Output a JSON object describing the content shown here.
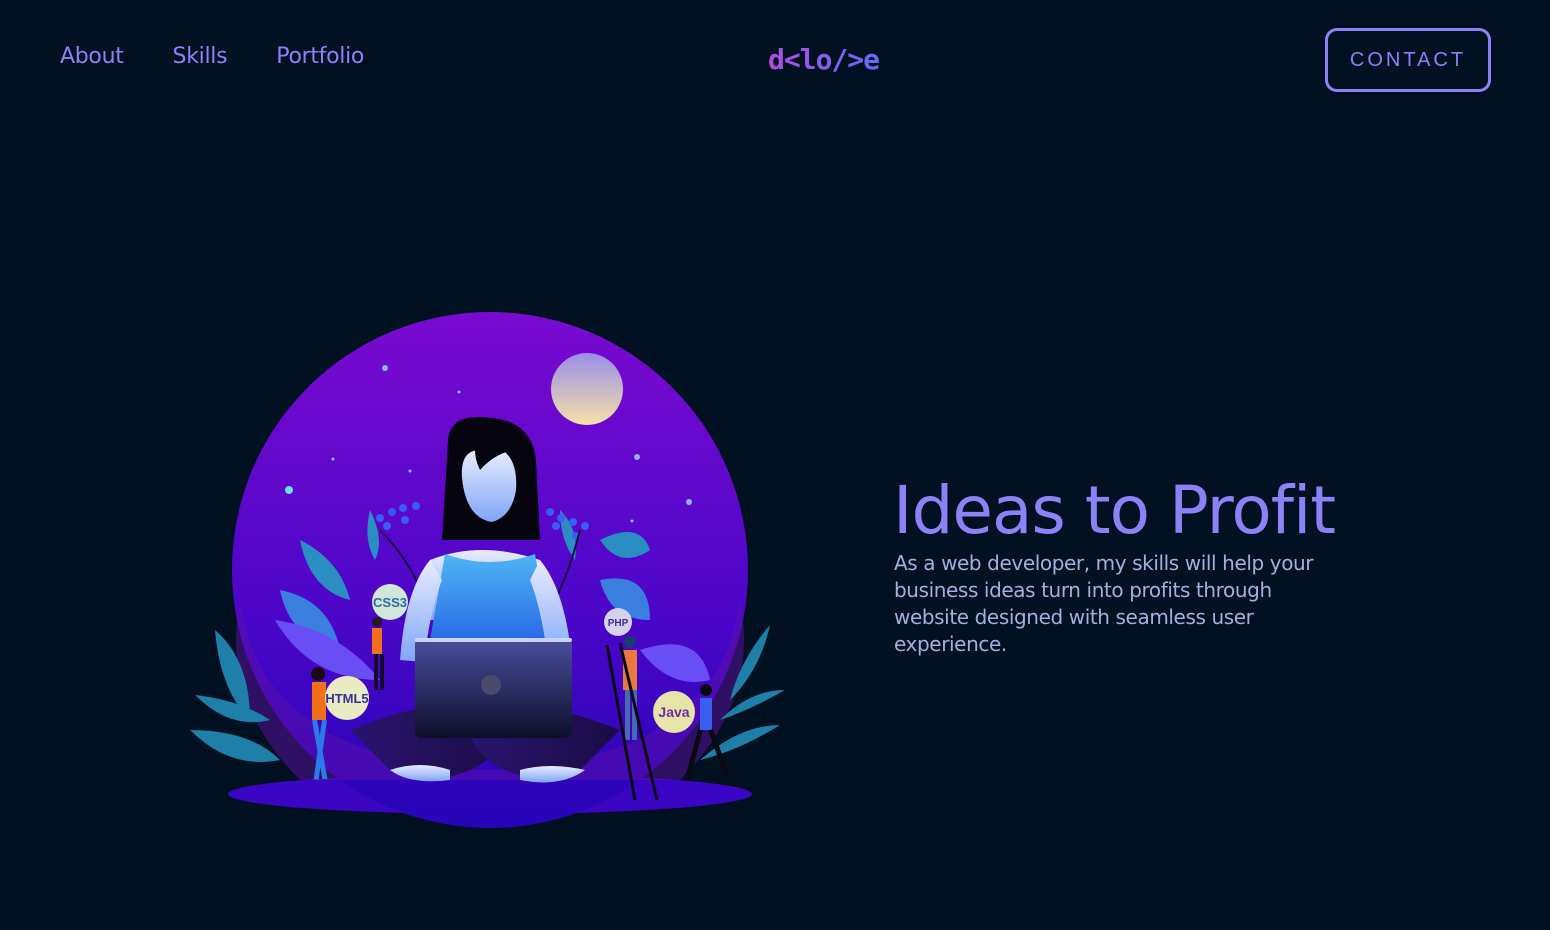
{
  "nav": {
    "items": [
      {
        "label": "About"
      },
      {
        "label": "Skills"
      },
      {
        "label": "Portfolio"
      }
    ]
  },
  "logo": {
    "text": "d<lo/>e",
    "gradient_start": "#b44be0",
    "gradient_end": "#5f6df5"
  },
  "header": {
    "contact_label": "CONTACT"
  },
  "hero": {
    "title": "Ideas to Profit",
    "description": "As a web developer, my skills will help your business ideas turn into profits through website designed with seamless user experience.",
    "illustration": {
      "badges": [
        {
          "label": "CSS3"
        },
        {
          "label": "PHP"
        },
        {
          "label": "HTML5"
        },
        {
          "label": "Java"
        }
      ]
    }
  },
  "colors": {
    "background": "#021122",
    "accent": "#8b82f6",
    "text_muted": "#9fb1e0"
  }
}
